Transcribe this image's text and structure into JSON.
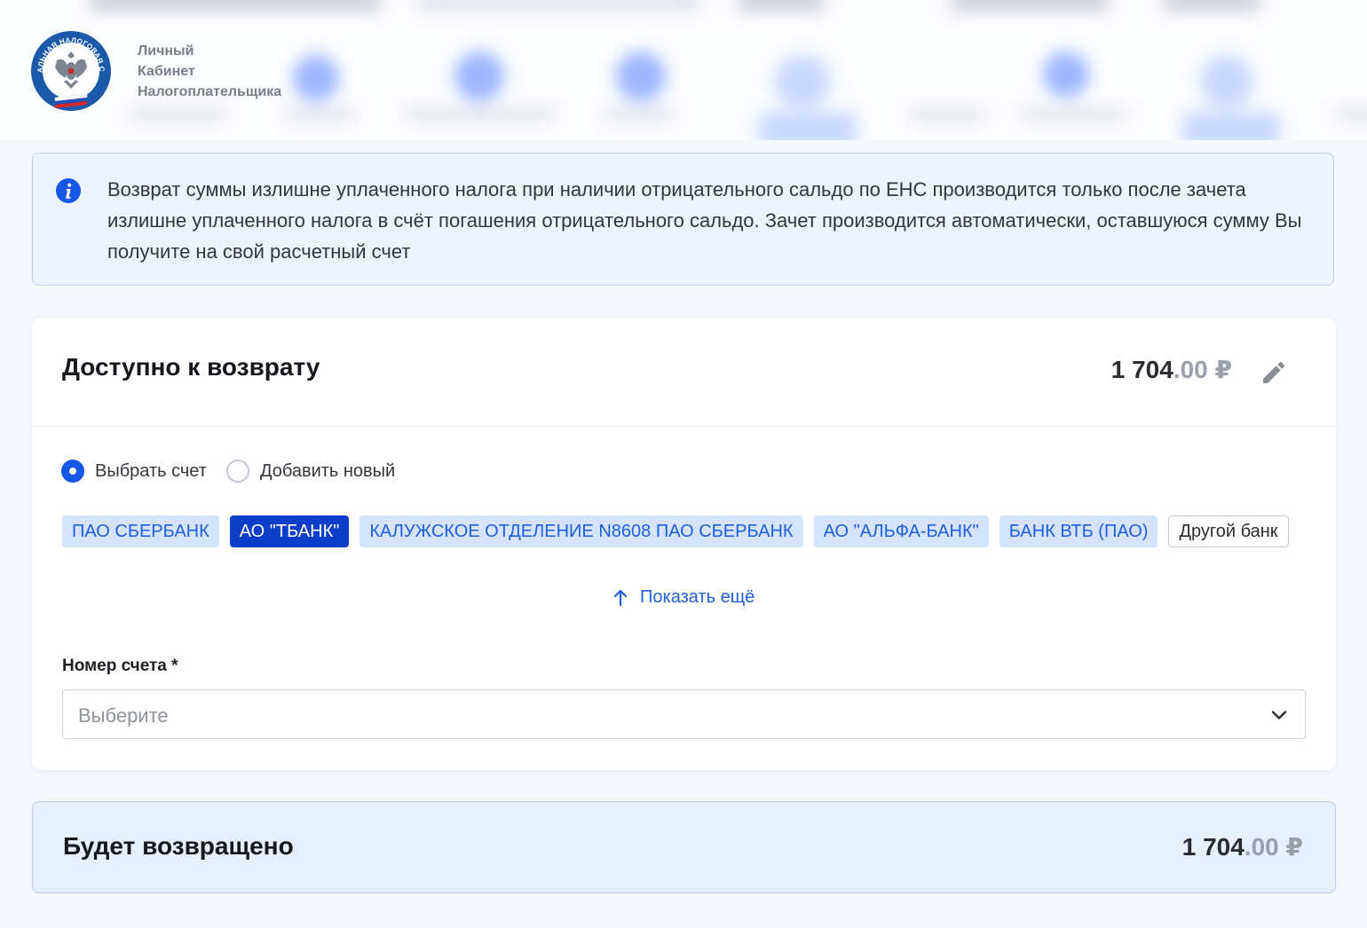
{
  "header": {
    "brand_line1": "Личный",
    "brand_line2": "Кабинет",
    "brand_line3": "Налогоплательщика",
    "logo_text": "ФЕДЕРАЛЬНАЯ НАЛОГОВАЯ СЛУЖБА"
  },
  "info": {
    "text": "Возврат суммы излишне уплаченного налога при наличии отрицательного сальдо по ЕНС производится только после зачета излишне уплаченного налога в счёт погашения отрицательного сальдо. Зачет производится автоматически, оставшуюся сумму Вы получите на свой расчетный счет",
    "icon": "info-icon"
  },
  "refund": {
    "title": "Доступно к возврату",
    "amount_int": "1 704",
    "amount_dec": ".00",
    "currency": "₽",
    "edit_icon": "pencil-icon"
  },
  "account_mode": {
    "options": [
      "Выбрать счет",
      "Добавить новый"
    ],
    "selected": "Выбрать счет"
  },
  "banks": {
    "items": [
      "ПАО СБЕРБАНК",
      "АО \"ТБАНК\"",
      "КАЛУЖСКОЕ ОТДЕЛЕНИЕ N8608 ПАО СБЕРБАНК",
      "АО \"АЛЬФА-БАНК\"",
      "БАНК ВТБ (ПАО)"
    ],
    "selected": "АО \"ТБАНК\"",
    "other": "Другой банк",
    "show_more": "Показать ещё"
  },
  "account_field": {
    "label": "Номер счета *",
    "placeholder": "Выберите"
  },
  "summary": {
    "title": "Будет возвращено",
    "amount_int": "1 704",
    "amount_dec": ".00",
    "currency": "₽"
  },
  "colors": {
    "primary": "#1557e6",
    "chip_active": "#0b3fc9",
    "chip_bg": "#d5e3ff",
    "link": "#1f5fe0",
    "page_bg": "#f5f8fe"
  }
}
